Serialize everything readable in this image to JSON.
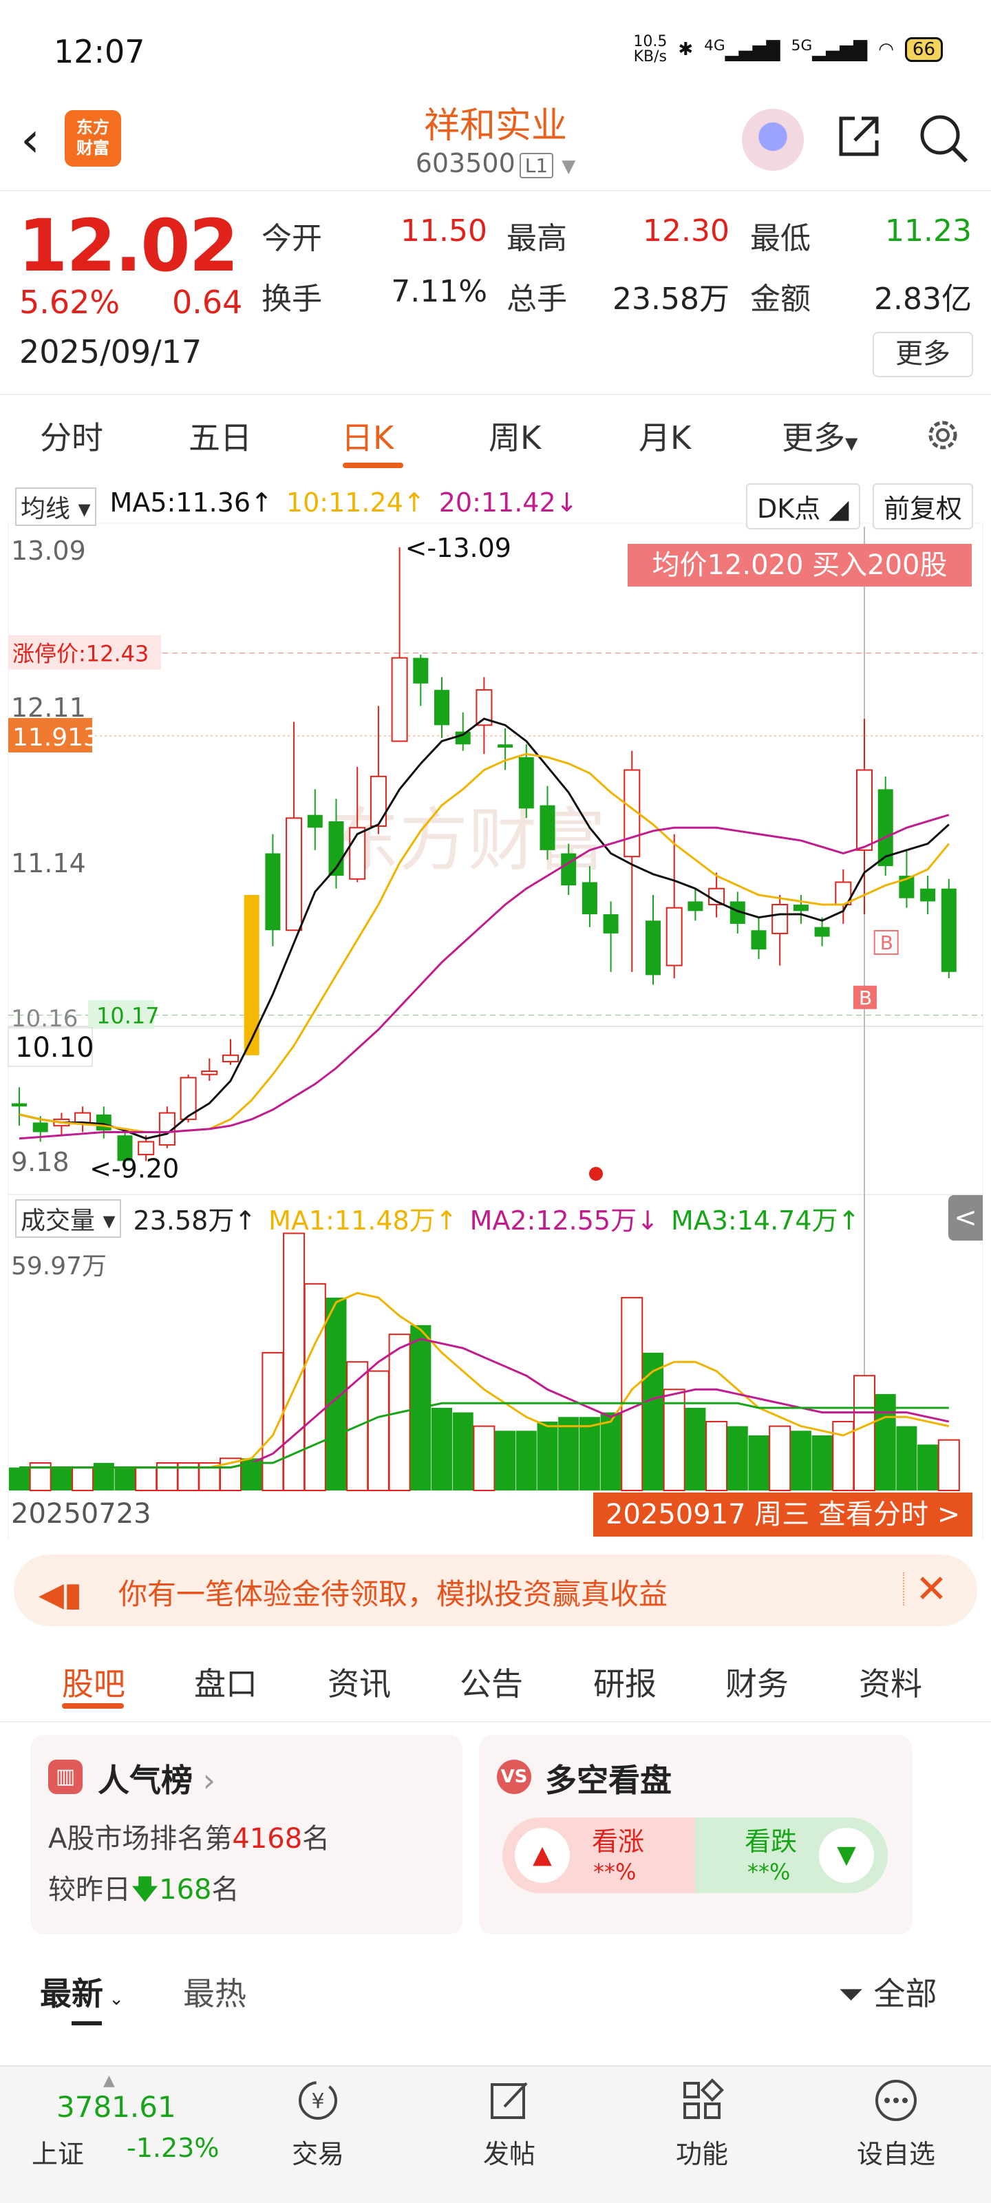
{
  "status_bar": {
    "time": "12:07",
    "net_speed": "10.5\nKB/s",
    "signal1": "4G",
    "signal2": "5G",
    "battery": "66"
  },
  "header": {
    "logo_text": "东方\n财富",
    "stock_name": "祥和实业",
    "stock_code": "603500",
    "code_badge": "L1"
  },
  "quote": {
    "price": "12.02",
    "change_pct": "5.62%",
    "change": "0.64",
    "date": "2025/09/17",
    "open_label": "今开",
    "open": "11.50",
    "high_label": "最高",
    "high": "12.30",
    "low_label": "最低",
    "low": "11.23",
    "turnover_label": "换手",
    "turnover": "7.11%",
    "volume_label": "总手",
    "volume": "23.58万",
    "amount_label": "金额",
    "amount": "2.83亿",
    "more": "更多"
  },
  "tabs": [
    "分时",
    "五日",
    "日K",
    "周K",
    "月K",
    "更多"
  ],
  "ma_legend": {
    "selector": "均线",
    "ma5": "MA5:11.36↑",
    "ma10": "10:11.24↑",
    "ma20": "20:11.42↓",
    "dk": "DK点",
    "adjust": "前复权"
  },
  "chart_labels": {
    "avg_banner": "均价12.020  买入200股",
    "y_top": "13.09",
    "limit_label": "涨停价:12.43",
    "y_mid1": "12.11",
    "cursor_price": "11.913",
    "y_mid2": "11.14",
    "y_low_cut": "10.16",
    "dash_price": "10.17",
    "y_low": "10.10",
    "y_bottom": "9.18",
    "high_mark": "<-13.09",
    "low_mark": "<-9.20",
    "buy_marker": "B",
    "watermark": "东方财富"
  },
  "volume_legend": {
    "selector": "成交量",
    "total": "23.58万↑",
    "ma1": "MA1:11.48万↑",
    "ma2": "MA2:12.55万↓",
    "ma3": "MA3:14.74万↑",
    "vmax": "59.97万",
    "toggle": "<"
  },
  "date_range": {
    "start": "20250723",
    "end": "20250917 周三 查看分时 >"
  },
  "chart_data": {
    "type": "candlestick",
    "price_axis_ticks": [
      "13.09",
      "12.11",
      "11.14",
      "10.16",
      "9.18"
    ],
    "candles": [
      [
        9.62,
        9.6,
        9.72,
        9.48
      ],
      [
        9.5,
        9.44,
        9.54,
        9.38
      ],
      [
        9.48,
        9.52,
        9.56,
        9.42
      ],
      [
        9.5,
        9.56,
        9.6,
        9.44
      ],
      [
        9.55,
        9.45,
        9.6,
        9.4
      ],
      [
        9.42,
        9.26,
        9.46,
        9.2
      ],
      [
        9.3,
        9.38,
        9.42,
        9.26
      ],
      [
        9.36,
        9.56,
        9.6,
        9.34
      ],
      [
        9.52,
        9.78,
        9.8,
        9.5
      ],
      [
        9.8,
        9.82,
        9.9,
        9.76
      ],
      [
        9.88,
        9.92,
        10.02,
        9.86
      ],
      [
        9.92,
        10.92,
        10.92,
        9.92
      ],
      [
        11.18,
        10.7,
        11.3,
        10.6
      ],
      [
        10.7,
        11.4,
        12.0,
        10.7
      ],
      [
        11.42,
        11.34,
        11.58,
        11.2
      ],
      [
        11.38,
        11.04,
        11.52,
        10.96
      ],
      [
        11.02,
        11.34,
        11.72,
        11.0
      ],
      [
        11.35,
        11.66,
        12.1,
        11.3
      ],
      [
        11.88,
        12.4,
        13.09,
        11.9
      ],
      [
        12.4,
        12.24,
        12.42,
        12.1
      ],
      [
        12.2,
        11.98,
        12.28,
        11.9
      ],
      [
        11.94,
        11.86,
        12.06,
        11.82
      ],
      [
        11.98,
        12.2,
        12.28,
        11.8
      ],
      [
        11.86,
        11.84,
        11.96,
        11.7
      ],
      [
        11.78,
        11.46,
        11.86,
        11.4
      ],
      [
        11.48,
        11.2,
        11.6,
        11.14
      ],
      [
        11.18,
        10.98,
        11.24,
        10.92
      ],
      [
        11.0,
        10.8,
        11.1,
        10.72
      ],
      [
        10.8,
        10.68,
        10.88,
        10.44
      ],
      [
        11.16,
        11.7,
        11.82,
        10.44
      ],
      [
        10.76,
        10.42,
        10.92,
        10.36
      ],
      [
        10.48,
        10.84,
        11.3,
        10.4
      ],
      [
        10.88,
        10.82,
        10.96,
        10.76
      ],
      [
        10.86,
        10.96,
        11.06,
        10.78
      ],
      [
        10.88,
        10.74,
        10.94,
        10.68
      ],
      [
        10.7,
        10.58,
        10.78,
        10.52
      ],
      [
        10.68,
        10.86,
        10.92,
        10.48
      ],
      [
        10.86,
        10.82,
        10.92,
        10.74
      ],
      [
        10.72,
        10.66,
        10.78,
        10.6
      ],
      [
        10.86,
        11.0,
        11.08,
        10.74
      ],
      [
        11.2,
        11.7,
        12.02,
        10.8
      ],
      [
        11.58,
        11.1,
        11.66,
        11.04
      ],
      [
        11.04,
        10.9,
        11.2,
        10.84
      ],
      [
        10.96,
        10.88,
        11.04,
        10.8
      ],
      [
        10.96,
        10.44,
        11.02,
        10.4
      ]
    ],
    "ma5": [
      9.55,
      9.52,
      9.5,
      9.5,
      9.49,
      9.45,
      9.4,
      9.43,
      9.54,
      9.62,
      9.76,
      10.02,
      10.3,
      10.62,
      10.94,
      11.09,
      11.3,
      11.36,
      11.58,
      11.74,
      11.88,
      11.92,
      12.02,
      11.98,
      11.88,
      11.72,
      11.56,
      11.34,
      11.18,
      11.11,
      11.05,
      11.01,
      10.96,
      10.88,
      10.82,
      10.78,
      10.8,
      10.8,
      10.76,
      10.82,
      11.06,
      11.16,
      11.2,
      11.24,
      11.36
    ],
    "ma10": [
      9.55,
      9.52,
      9.5,
      9.49,
      9.48,
      9.46,
      9.44,
      9.44,
      9.45,
      9.46,
      9.52,
      9.64,
      9.8,
      9.98,
      10.2,
      10.42,
      10.64,
      10.86,
      11.12,
      11.32,
      11.48,
      11.58,
      11.7,
      11.76,
      11.8,
      11.78,
      11.74,
      11.68,
      11.56,
      11.46,
      11.36,
      11.24,
      11.14,
      11.04,
      10.98,
      10.92,
      10.9,
      10.88,
      10.86,
      10.86,
      10.92,
      10.98,
      11.02,
      11.08,
      11.24
    ],
    "ma20": [
      9.4,
      9.41,
      9.42,
      9.43,
      9.44,
      9.44,
      9.44,
      9.44,
      9.45,
      9.46,
      9.48,
      9.52,
      9.58,
      9.66,
      9.74,
      9.84,
      9.96,
      10.08,
      10.22,
      10.36,
      10.5,
      10.62,
      10.74,
      10.86,
      10.96,
      11.04,
      11.12,
      11.2,
      11.24,
      11.28,
      11.32,
      11.34,
      11.34,
      11.34,
      11.32,
      11.3,
      11.28,
      11.26,
      11.22,
      11.18,
      11.22,
      11.28,
      11.34,
      11.38,
      11.42
    ],
    "volumes": [
      5,
      6,
      5,
      5,
      6,
      5,
      5,
      6,
      6,
      6,
      7,
      7,
      30,
      56,
      45,
      42,
      28,
      26,
      34,
      36,
      18,
      17,
      14,
      13,
      13,
      15,
      16,
      16,
      17,
      42,
      30,
      22,
      18,
      15,
      14,
      12,
      14,
      13,
      12,
      15,
      25,
      21,
      14,
      10,
      11
    ],
    "volume_up": [
      false,
      true,
      false,
      true,
      false,
      false,
      true,
      true,
      true,
      true,
      true,
      false,
      true,
      true,
      true,
      false,
      true,
      true,
      true,
      false,
      false,
      false,
      true,
      false,
      false,
      false,
      false,
      false,
      false,
      true,
      false,
      true,
      false,
      true,
      false,
      false,
      true,
      false,
      false,
      true,
      true,
      false,
      false,
      false,
      true
    ],
    "vol_ma1": [
      5,
      5,
      5,
      5,
      5,
      5,
      5,
      5,
      5,
      5,
      6,
      7,
      12,
      22,
      32,
      41,
      43,
      42,
      38,
      35,
      30,
      26,
      22,
      19,
      16,
      14,
      14,
      14,
      15,
      22,
      26,
      28,
      28,
      26,
      22,
      18,
      16,
      14,
      13,
      12,
      14,
      16,
      16,
      15,
      14
    ],
    "vol_ma2": [
      5,
      5,
      5,
      5,
      5,
      5,
      5,
      5,
      5,
      5,
      5,
      6,
      8,
      12,
      16,
      20,
      24,
      28,
      31,
      33,
      32,
      31,
      29,
      27,
      25,
      22,
      20,
      18,
      16,
      18,
      20,
      21,
      22,
      22,
      21,
      20,
      19,
      18,
      17,
      17,
      17,
      17,
      17,
      16,
      15
    ],
    "vol_ma3": [
      5,
      5,
      5,
      5,
      5,
      5,
      5,
      5,
      5,
      5,
      5,
      6,
      6,
      8,
      10,
      12,
      14,
      16,
      17,
      18,
      19,
      19,
      19,
      19,
      19,
      19,
      19,
      19,
      19,
      19,
      19,
      19,
      19,
      19,
      19,
      18,
      18,
      18,
      18,
      18,
      18,
      18,
      18,
      18,
      18
    ],
    "volume_axis_max": "59.97万"
  },
  "promo": {
    "text": "你有一笔体验金待领取，模拟投资赢真收益"
  },
  "sub_tabs": [
    "股吧",
    "盘口",
    "资讯",
    "公告",
    "研报",
    "财务",
    "资料"
  ],
  "popularity": {
    "title": "人气榜",
    "line1_prefix": "A股市场排名第",
    "rank": "4168",
    "line1_suffix": "名",
    "line2_prefix": "较昨日",
    "delta": "168",
    "line2_suffix": "名"
  },
  "long_short": {
    "icon": "VS",
    "title": "多空看盘",
    "bull_label": "看涨",
    "bull_val": "**%",
    "bear_label": "看跌",
    "bear_val": "**%"
  },
  "filter": {
    "newest": "最新",
    "hot": "最热",
    "all": "全部"
  },
  "bottom_nav": {
    "index_value": "3781.61",
    "index_name": "上证",
    "index_pct": "-1.23%",
    "items": [
      {
        "label": "交易",
        "icon": "yen-icon"
      },
      {
        "label": "发帖",
        "icon": "edit-icon"
      },
      {
        "label": "功能",
        "icon": "grid-icon"
      },
      {
        "label": "设自选",
        "icon": "more-dots-icon"
      }
    ]
  },
  "colors": {
    "up": "#e0221a",
    "down": "#18a418",
    "accent": "#e8601c",
    "ma5": "#111111",
    "ma10": "#f0b400",
    "ma20": "#c21b8e"
  }
}
